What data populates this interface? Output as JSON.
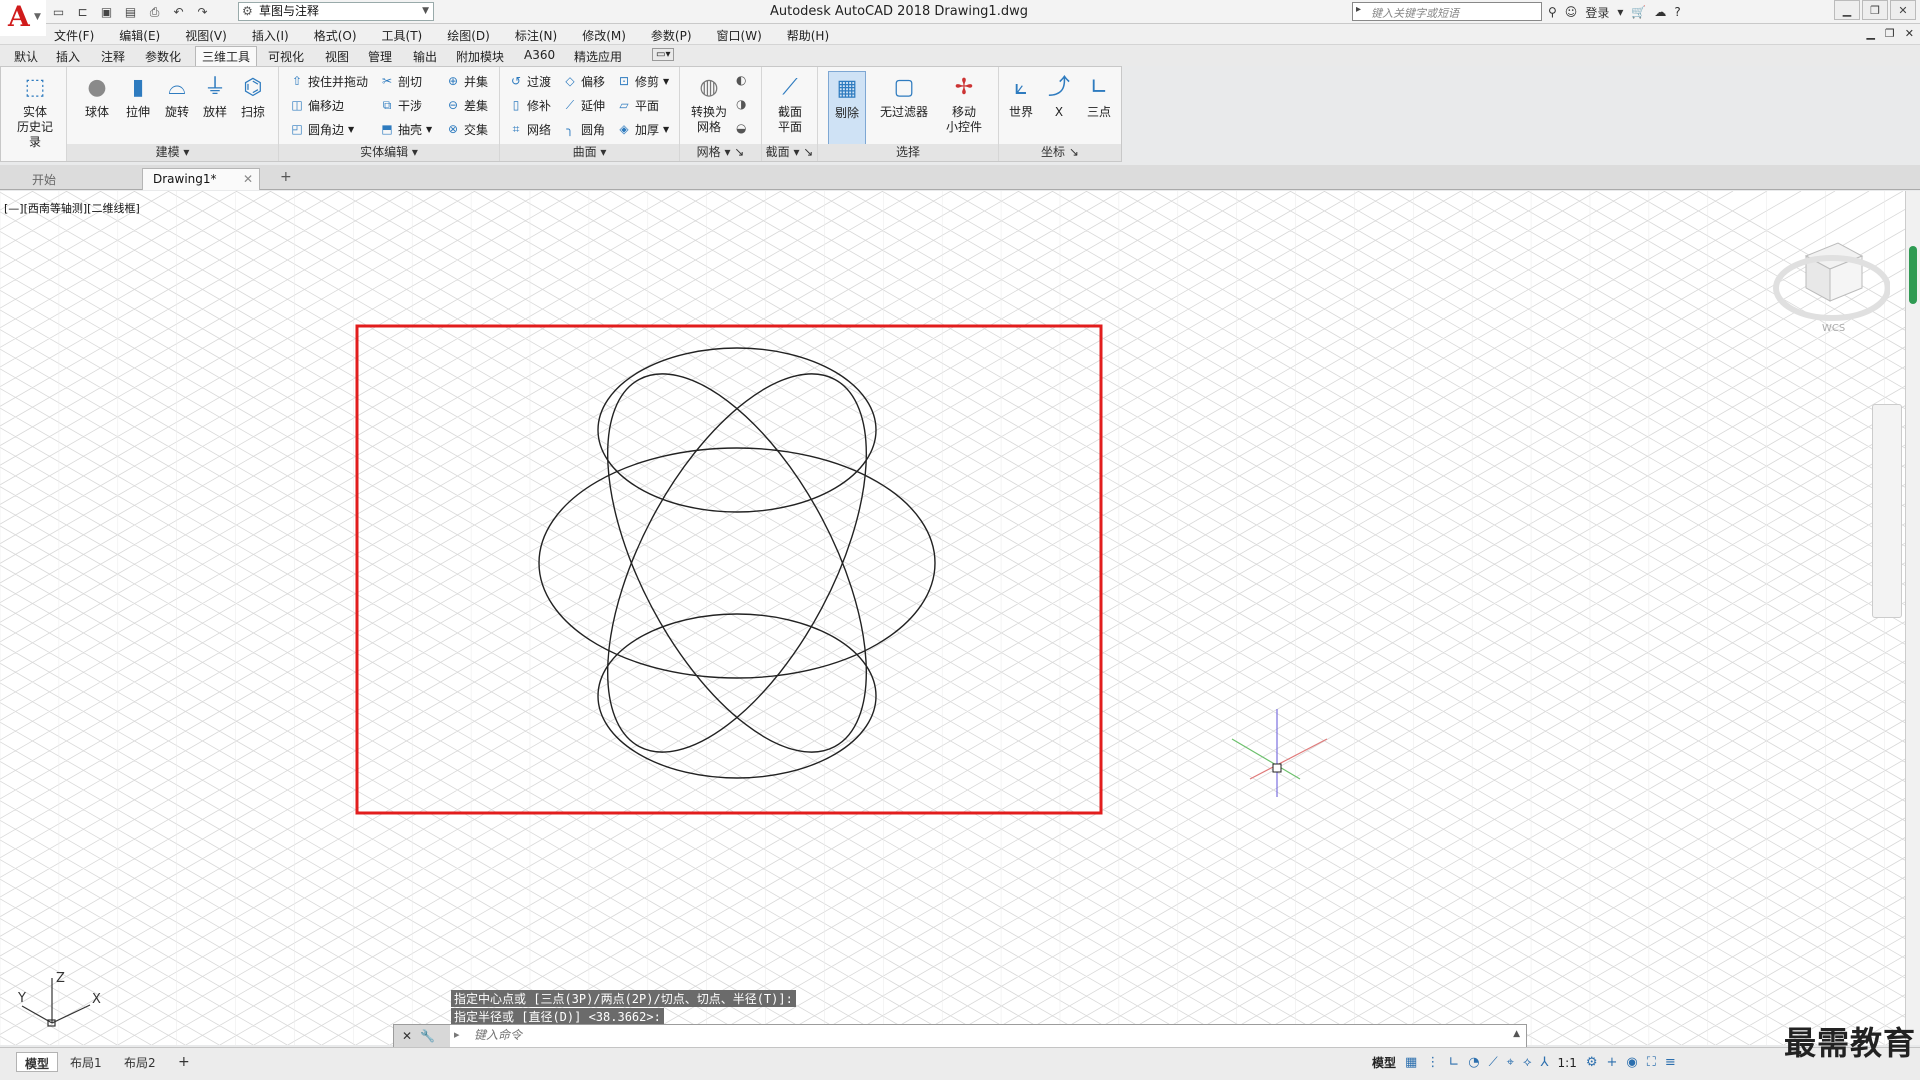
{
  "title_bar": {
    "title": "Autodesk AutoCAD 2018    Drawing1.dwg",
    "workspace": "草图与注释",
    "search_placeholder": "键入关键字或短语",
    "login": "登录"
  },
  "menu": [
    "文件(F)",
    "编辑(E)",
    "视图(V)",
    "插入(I)",
    "格式(O)",
    "工具(T)",
    "绘图(D)",
    "标注(N)",
    "修改(M)",
    "参数(P)",
    "窗口(W)",
    "帮助(H)"
  ],
  "ribbon_tabs": [
    "默认",
    "插入",
    "注释",
    "参数化",
    "三维工具",
    "可视化",
    "视图",
    "管理",
    "输出",
    "附加模块",
    "A360",
    "精选应用"
  ],
  "ribbon_active_tab": "三维工具",
  "ribbon": {
    "history_label": "实体\n历史记录",
    "modeling": {
      "title": "建模",
      "buttons": [
        "球体",
        "拉伸",
        "旋转",
        "放样",
        "扫掠"
      ]
    },
    "solid_edit": {
      "title": "实体编辑",
      "buttons": [
        "按住并拖动",
        "偏移边",
        "圆角边",
        "剖切",
        "干涉",
        "抽壳",
        "并集",
        "差集",
        "交集"
      ]
    },
    "surface": {
      "title": "曲面",
      "buttons": [
        "过渡",
        "修补",
        "网络",
        "偏移",
        "延伸",
        "圆角",
        "修剪",
        "平面",
        "加厚"
      ]
    },
    "mesh": {
      "title": "网格",
      "buttons": [
        "转换为\n网格"
      ]
    },
    "section": {
      "title": "截面",
      "buttons": [
        "截面\n平面"
      ]
    },
    "selection": {
      "title": "选择",
      "buttons": [
        "剔除",
        "无过滤器",
        "移动\n小控件"
      ]
    },
    "coords": {
      "title": "坐标",
      "buttons": [
        "世界",
        "X",
        "三点"
      ]
    }
  },
  "file_tabs": [
    "开始",
    "Drawing1*"
  ],
  "viewport": {
    "label": "[—][西南等轴测][二维线框]",
    "viewcube_label": "WCS",
    "axis_labels": [
      "Z",
      "Y",
      "X"
    ]
  },
  "command": {
    "history": [
      "指定中心点或 [三点(3P)/两点(2P)/切点、切点、半径(T)]:",
      "指定半径或 [直径(D)] <38.3662>:"
    ],
    "placeholder": "键入命令"
  },
  "layout_tabs": [
    "模型",
    "布局1",
    "布局2"
  ],
  "status": {
    "model": "模型",
    "scale": "1:1"
  },
  "watermark": "最需教育",
  "colors": {
    "highlight_box": "#e21d1d",
    "accent": "#2e7bbf"
  }
}
